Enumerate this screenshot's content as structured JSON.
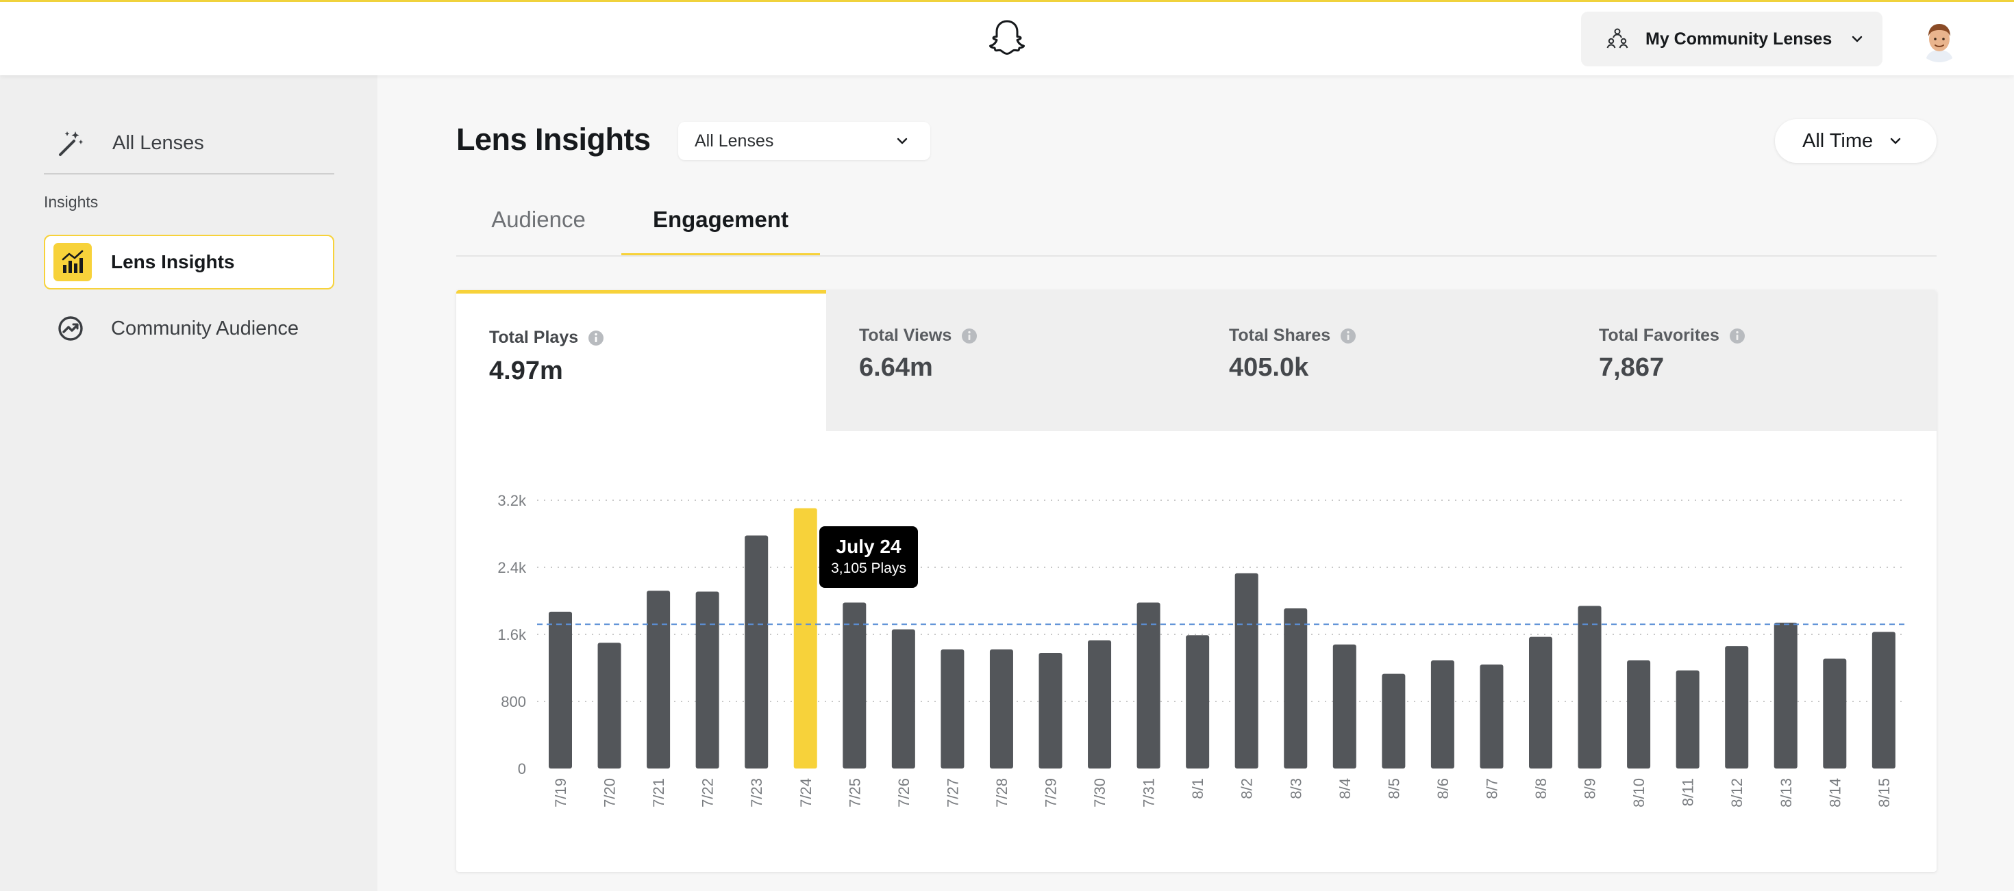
{
  "topbar": {
    "lens_menu_label": "My Community Lenses",
    "logo_icon": "snapchat-ghost-icon",
    "menu_icon": "people-network-icon"
  },
  "sidebar": {
    "all_lenses": "All Lenses",
    "section": "Insights",
    "items": [
      {
        "label": "Lens Insights",
        "icon": "bar-chart-icon",
        "active": true
      },
      {
        "label": "Community Audience",
        "icon": "audience-trend-icon",
        "active": false
      }
    ]
  },
  "header": {
    "title": "Lens Insights",
    "lens_filter": "All Lenses",
    "time_filter": "All Time"
  },
  "tabs": [
    {
      "label": "Audience",
      "active": false
    },
    {
      "label": "Engagement",
      "active": true
    }
  ],
  "metrics": [
    {
      "label": "Total Plays",
      "value": "4.97m",
      "active": true
    },
    {
      "label": "Total Views",
      "value": "6.64m",
      "active": false
    },
    {
      "label": "Total Shares",
      "value": "405.0k",
      "active": false
    },
    {
      "label": "Total Favorites",
      "value": "7,867",
      "active": false
    }
  ],
  "tooltip": {
    "date": "July 24",
    "value": "3,105 Plays"
  },
  "colors": {
    "accent": "#f7d23a",
    "bar": "#53565a",
    "average_line": "#5b8fd6"
  },
  "chart_data": {
    "type": "bar",
    "categories": [
      "7/19",
      "7/20",
      "7/21",
      "7/22",
      "7/23",
      "7/24",
      "7/25",
      "7/26",
      "7/27",
      "7/28",
      "7/29",
      "7/30",
      "7/31",
      "8/1",
      "8/2",
      "8/3",
      "8/4",
      "8/5",
      "8/6",
      "8/7",
      "8/8",
      "8/9",
      "8/10",
      "8/11",
      "8/12",
      "8/13",
      "8/14",
      "8/15"
    ],
    "values": [
      1870,
      1500,
      2120,
      2110,
      2780,
      3105,
      1980,
      1660,
      1420,
      1420,
      1380,
      1530,
      1980,
      1590,
      2330,
      1910,
      1480,
      1130,
      1290,
      1240,
      1570,
      1940,
      1290,
      1170,
      1460,
      1740,
      1310,
      1630
    ],
    "highlight_index": 5,
    "average_line": 1720,
    "yticks": [
      {
        "v": 0,
        "label": "0"
      },
      {
        "v": 800,
        "label": "800"
      },
      {
        "v": 1600,
        "label": "1.6k"
      },
      {
        "v": 2400,
        "label": "2.4k"
      },
      {
        "v": 3200,
        "label": "3.2k"
      }
    ],
    "ylim": [
      0,
      3200
    ],
    "grid": "dotted horizontal"
  }
}
